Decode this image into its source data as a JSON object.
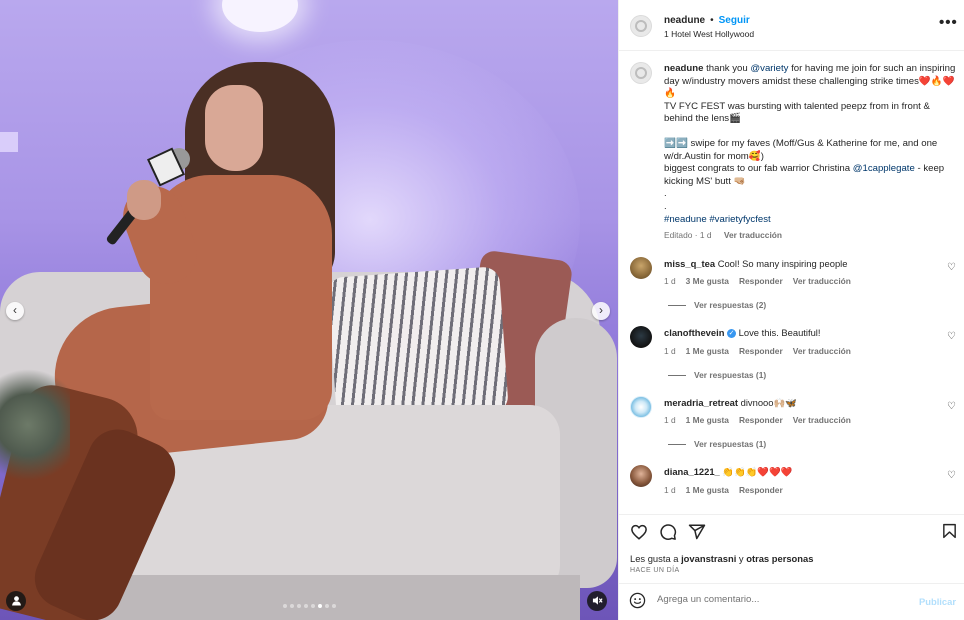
{
  "post": {
    "username": "neadune",
    "separator": "•",
    "follow_label": "Seguir",
    "location": "1 Hotel West Hollywood",
    "more_label": "•••"
  },
  "media": {
    "prev_label": "‹",
    "next_label": "›",
    "slide_count": 8,
    "active_slide": 6,
    "tag_icon": "person-icon",
    "mute_icon": "speaker-muted-icon"
  },
  "caption": {
    "username": "neadune",
    "line1_pre": "thank you ",
    "mention1": "@variety",
    "line1_post": " for having me join for such an inspiring day w/industry movers amidst these challenging strike times❤️🔥❤️🔥",
    "line2": "TV FYC FEST was bursting with talented peepz from in front & behind the lens🎬",
    "line3": "➡️➡️ swipe for my faves (Moff/Gus & Katherine for me, and one w/dr.Austin for mom🥰)",
    "line4_pre": "biggest congrats to our fab warrior Christina ",
    "mention2": "@1capplegate",
    "line4_post": " - keep kicking MS' butt 🤜🏼",
    "dot1": ".",
    "dot2": ".",
    "hashtags": "#neadune #varietyfycfest",
    "edited": "Editado · 1 d",
    "translate": "Ver traducción"
  },
  "comments": [
    {
      "username": "miss_q_tea",
      "text": "Cool! So many inspiring people",
      "age": "1 d",
      "likes": "3 Me gusta",
      "reply": "Responder",
      "translate": "Ver traducción",
      "replies": "Ver respuestas (2)",
      "verified": false
    },
    {
      "username": "clanofthevein",
      "text": "Love this. Beautiful!",
      "age": "1 d",
      "likes": "1 Me gusta",
      "reply": "Responder",
      "translate": "Ver traducción",
      "replies": "Ver respuestas (1)",
      "verified": true
    },
    {
      "username": "meradria_retreat",
      "text": "divnooo🙌🏼🦋",
      "age": "1 d",
      "likes": "1 Me gusta",
      "reply": "Responder",
      "translate": "Ver traducción",
      "replies": "Ver respuestas (1)",
      "verified": false
    },
    {
      "username": "diana_1221_",
      "text": "👏👏👏❤️❤️❤️",
      "age": "1 d",
      "likes": "1 Me gusta",
      "reply": "Responder",
      "verified": false
    }
  ],
  "footer": {
    "likes_pre": "Les gusta a ",
    "likes_user": "jovanstrasni",
    "likes_mid": " y ",
    "likes_others": "otras personas",
    "date": "HACE UN DÍA",
    "comment_placeholder": "Agrega un comentario...",
    "publish_label": "Publicar"
  },
  "icons": {
    "like": "heart-icon",
    "comment": "comment-icon",
    "share": "send-icon",
    "save": "bookmark-icon",
    "emoji": "emoji-icon"
  },
  "colors": {
    "accent": "#0095f6",
    "link": "#00376b",
    "muted": "#737373",
    "publish_disabled": "#b2dffc"
  }
}
